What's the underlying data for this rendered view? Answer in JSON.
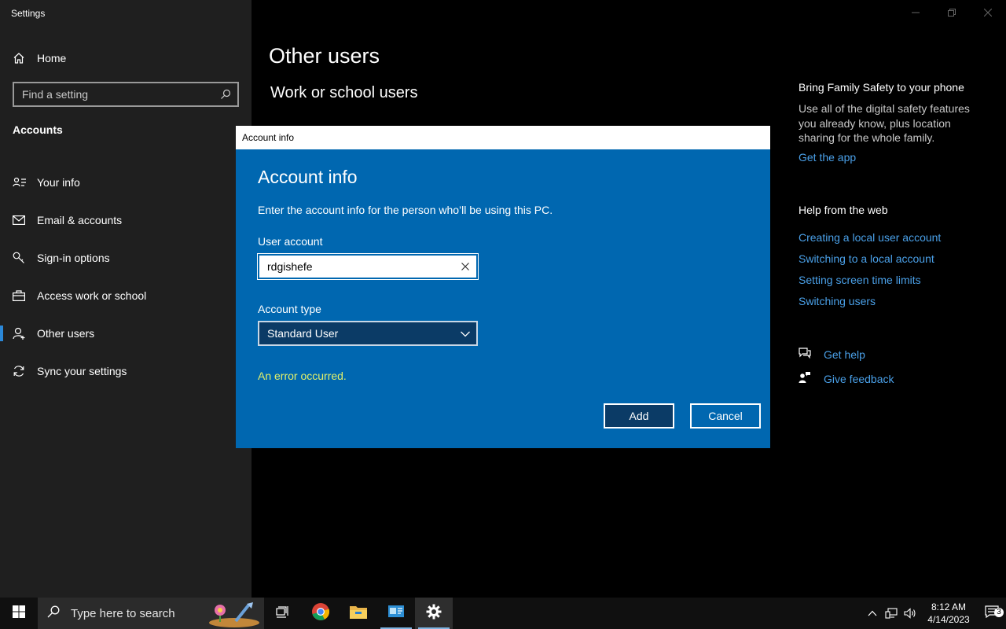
{
  "window": {
    "title": "Settings"
  },
  "sidebar": {
    "home_label": "Home",
    "search_placeholder": "Find a setting",
    "section": "Accounts",
    "items": [
      {
        "label": "Your info",
        "icon": "person-card-icon"
      },
      {
        "label": "Email & accounts",
        "icon": "mail-icon"
      },
      {
        "label": "Sign-in options",
        "icon": "key-icon"
      },
      {
        "label": "Access work or school",
        "icon": "briefcase-icon"
      },
      {
        "label": "Other users",
        "icon": "person-add-icon",
        "active": true
      },
      {
        "label": "Sync your settings",
        "icon": "sync-icon"
      }
    ]
  },
  "main": {
    "title": "Other users",
    "subtitle": "Work or school users"
  },
  "right": {
    "family_heading": "Bring Family Safety to your phone",
    "family_text": "Use all of the digital safety features you already know, plus location sharing for the whole family.",
    "get_app": "Get the app",
    "help_heading": "Help from the web",
    "help_links": [
      "Creating a local user account",
      "Switching to a local account",
      "Setting screen time limits",
      "Switching users"
    ],
    "get_help": "Get help",
    "give_feedback": "Give feedback"
  },
  "dialog": {
    "titlebar": "Account info",
    "heading": "Account info",
    "description": "Enter the account info for the person who’ll be using this PC.",
    "user_label": "User account",
    "user_value": "rdgishefe",
    "type_label": "Account type",
    "type_value": "Standard User",
    "error": "An error occurred.",
    "add": "Add",
    "cancel": "Cancel"
  },
  "taskbar": {
    "search_placeholder": "Type here to search",
    "time": "8:12 AM",
    "date": "4/14/2023",
    "notification_count": "3"
  },
  "colors": {
    "dialog_bg": "#0067b0",
    "accent": "#4aa0e8",
    "error": "#e2f06a",
    "sidebar_bg": "#1f1f1f"
  }
}
